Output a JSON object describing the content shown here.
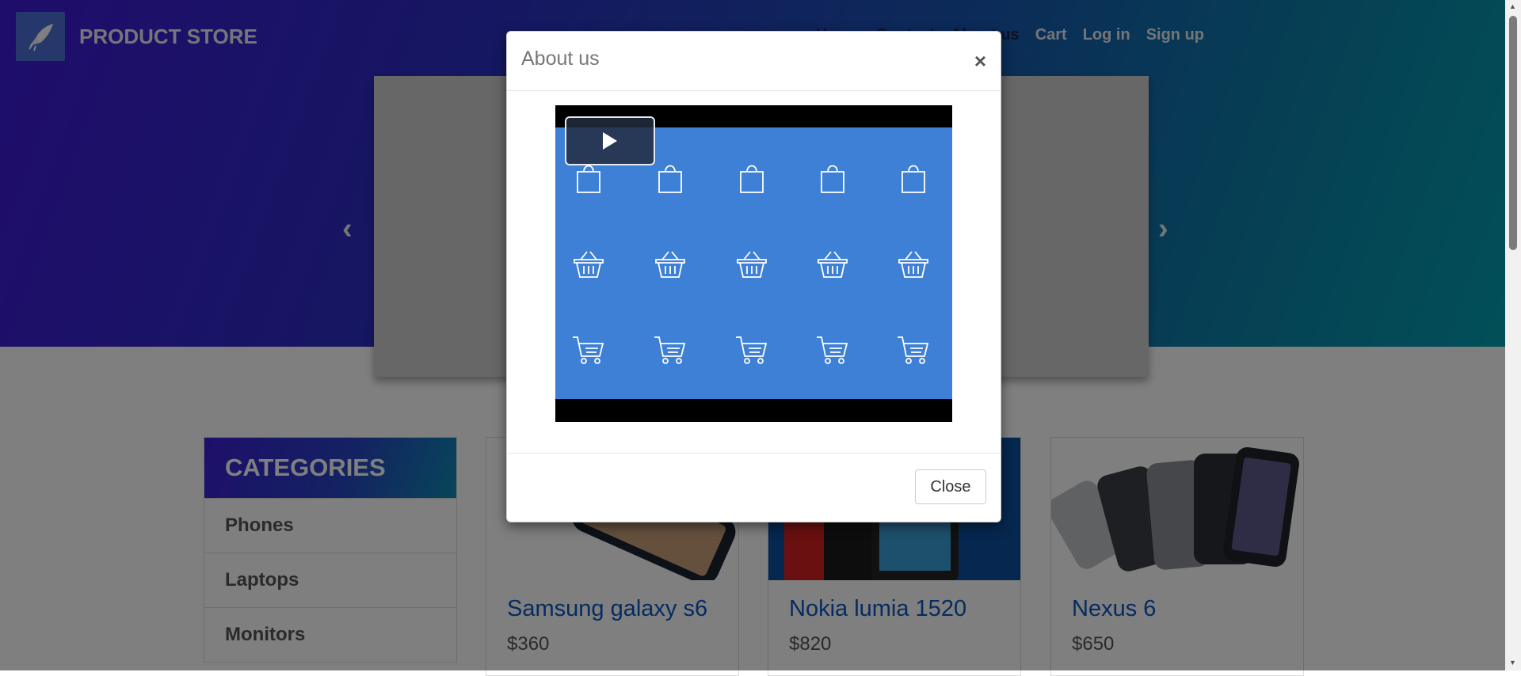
{
  "header": {
    "brand": "PRODUCT STORE",
    "nav": [
      "Home",
      "Contact",
      "About us",
      "Cart",
      "Log in",
      "Sign up"
    ]
  },
  "carousel": {
    "prev_icon": "chevron-left-icon",
    "next_icon": "chevron-right-icon"
  },
  "categories": {
    "title": "CATEGORIES",
    "items": [
      "Phones",
      "Laptops",
      "Monitors"
    ]
  },
  "products": [
    {
      "name": "Samsung galaxy s6",
      "price": "$360"
    },
    {
      "name": "Nokia lumia 1520",
      "price": "$820"
    },
    {
      "name": "Nexus 6",
      "price": "$650"
    }
  ],
  "modal": {
    "title": "About us",
    "close_x": "×",
    "close_button": "Close",
    "video": {
      "play_icon": "play-icon",
      "icons": [
        "shopping-bag-icon",
        "shopping-basket-icon",
        "shopping-cart-icon"
      ]
    }
  },
  "colors": {
    "accent": "#0b57c1",
    "video_bg": "#3e80d6"
  }
}
